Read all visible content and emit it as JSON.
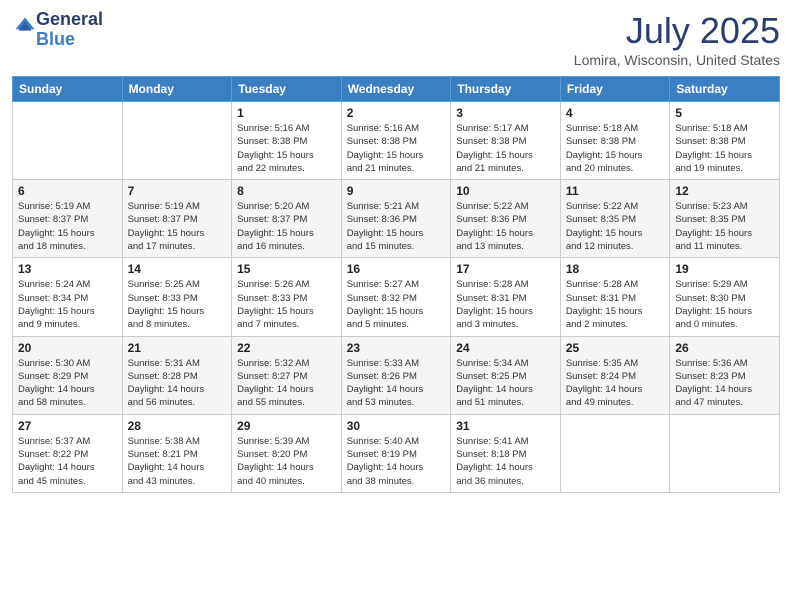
{
  "logo": {
    "general": "General",
    "blue": "Blue"
  },
  "header": {
    "month": "July 2025",
    "location": "Lomira, Wisconsin, United States"
  },
  "weekdays": [
    "Sunday",
    "Monday",
    "Tuesday",
    "Wednesday",
    "Thursday",
    "Friday",
    "Saturday"
  ],
  "weeks": [
    [
      {
        "day": "",
        "info": ""
      },
      {
        "day": "",
        "info": ""
      },
      {
        "day": "1",
        "info": "Sunrise: 5:16 AM\nSunset: 8:38 PM\nDaylight: 15 hours\nand 22 minutes."
      },
      {
        "day": "2",
        "info": "Sunrise: 5:16 AM\nSunset: 8:38 PM\nDaylight: 15 hours\nand 21 minutes."
      },
      {
        "day": "3",
        "info": "Sunrise: 5:17 AM\nSunset: 8:38 PM\nDaylight: 15 hours\nand 21 minutes."
      },
      {
        "day": "4",
        "info": "Sunrise: 5:18 AM\nSunset: 8:38 PM\nDaylight: 15 hours\nand 20 minutes."
      },
      {
        "day": "5",
        "info": "Sunrise: 5:18 AM\nSunset: 8:38 PM\nDaylight: 15 hours\nand 19 minutes."
      }
    ],
    [
      {
        "day": "6",
        "info": "Sunrise: 5:19 AM\nSunset: 8:37 PM\nDaylight: 15 hours\nand 18 minutes."
      },
      {
        "day": "7",
        "info": "Sunrise: 5:19 AM\nSunset: 8:37 PM\nDaylight: 15 hours\nand 17 minutes."
      },
      {
        "day": "8",
        "info": "Sunrise: 5:20 AM\nSunset: 8:37 PM\nDaylight: 15 hours\nand 16 minutes."
      },
      {
        "day": "9",
        "info": "Sunrise: 5:21 AM\nSunset: 8:36 PM\nDaylight: 15 hours\nand 15 minutes."
      },
      {
        "day": "10",
        "info": "Sunrise: 5:22 AM\nSunset: 8:36 PM\nDaylight: 15 hours\nand 13 minutes."
      },
      {
        "day": "11",
        "info": "Sunrise: 5:22 AM\nSunset: 8:35 PM\nDaylight: 15 hours\nand 12 minutes."
      },
      {
        "day": "12",
        "info": "Sunrise: 5:23 AM\nSunset: 8:35 PM\nDaylight: 15 hours\nand 11 minutes."
      }
    ],
    [
      {
        "day": "13",
        "info": "Sunrise: 5:24 AM\nSunset: 8:34 PM\nDaylight: 15 hours\nand 9 minutes."
      },
      {
        "day": "14",
        "info": "Sunrise: 5:25 AM\nSunset: 8:33 PM\nDaylight: 15 hours\nand 8 minutes."
      },
      {
        "day": "15",
        "info": "Sunrise: 5:26 AM\nSunset: 8:33 PM\nDaylight: 15 hours\nand 7 minutes."
      },
      {
        "day": "16",
        "info": "Sunrise: 5:27 AM\nSunset: 8:32 PM\nDaylight: 15 hours\nand 5 minutes."
      },
      {
        "day": "17",
        "info": "Sunrise: 5:28 AM\nSunset: 8:31 PM\nDaylight: 15 hours\nand 3 minutes."
      },
      {
        "day": "18",
        "info": "Sunrise: 5:28 AM\nSunset: 8:31 PM\nDaylight: 15 hours\nand 2 minutes."
      },
      {
        "day": "19",
        "info": "Sunrise: 5:29 AM\nSunset: 8:30 PM\nDaylight: 15 hours\nand 0 minutes."
      }
    ],
    [
      {
        "day": "20",
        "info": "Sunrise: 5:30 AM\nSunset: 8:29 PM\nDaylight: 14 hours\nand 58 minutes."
      },
      {
        "day": "21",
        "info": "Sunrise: 5:31 AM\nSunset: 8:28 PM\nDaylight: 14 hours\nand 56 minutes."
      },
      {
        "day": "22",
        "info": "Sunrise: 5:32 AM\nSunset: 8:27 PM\nDaylight: 14 hours\nand 55 minutes."
      },
      {
        "day": "23",
        "info": "Sunrise: 5:33 AM\nSunset: 8:26 PM\nDaylight: 14 hours\nand 53 minutes."
      },
      {
        "day": "24",
        "info": "Sunrise: 5:34 AM\nSunset: 8:25 PM\nDaylight: 14 hours\nand 51 minutes."
      },
      {
        "day": "25",
        "info": "Sunrise: 5:35 AM\nSunset: 8:24 PM\nDaylight: 14 hours\nand 49 minutes."
      },
      {
        "day": "26",
        "info": "Sunrise: 5:36 AM\nSunset: 8:23 PM\nDaylight: 14 hours\nand 47 minutes."
      }
    ],
    [
      {
        "day": "27",
        "info": "Sunrise: 5:37 AM\nSunset: 8:22 PM\nDaylight: 14 hours\nand 45 minutes."
      },
      {
        "day": "28",
        "info": "Sunrise: 5:38 AM\nSunset: 8:21 PM\nDaylight: 14 hours\nand 43 minutes."
      },
      {
        "day": "29",
        "info": "Sunrise: 5:39 AM\nSunset: 8:20 PM\nDaylight: 14 hours\nand 40 minutes."
      },
      {
        "day": "30",
        "info": "Sunrise: 5:40 AM\nSunset: 8:19 PM\nDaylight: 14 hours\nand 38 minutes."
      },
      {
        "day": "31",
        "info": "Sunrise: 5:41 AM\nSunset: 8:18 PM\nDaylight: 14 hours\nand 36 minutes."
      },
      {
        "day": "",
        "info": ""
      },
      {
        "day": "",
        "info": ""
      }
    ]
  ]
}
